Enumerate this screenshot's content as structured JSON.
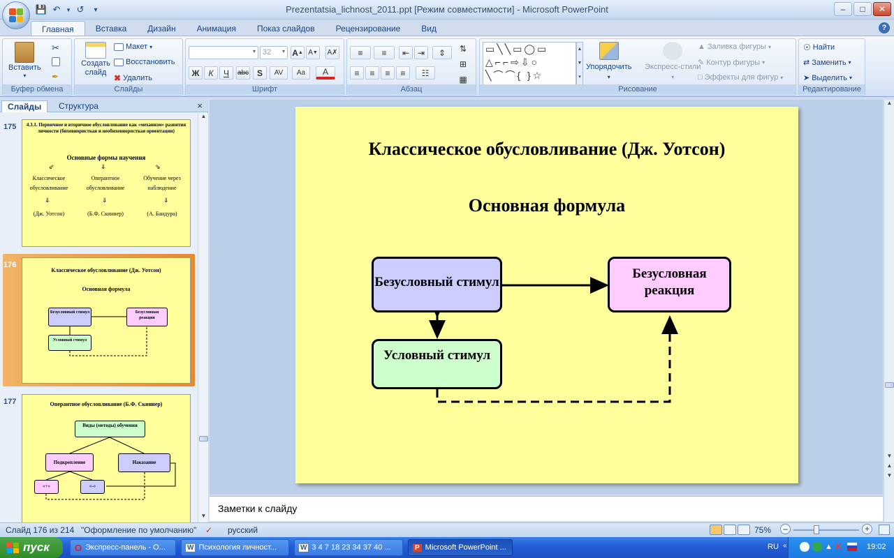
{
  "window": {
    "title": "Prezentatsia_lichnost_2011.ppt [Режим совместимости] - Microsoft PowerPoint",
    "tabs": [
      "Главная",
      "Вставка",
      "Дизайн",
      "Анимация",
      "Показ слайдов",
      "Рецензирование",
      "Вид"
    ],
    "active_tab": "Главная"
  },
  "ribbon": {
    "clipboard": {
      "label": "Буфер обмена",
      "paste": "Вставить"
    },
    "slides": {
      "label": "Слайды",
      "new_slide": "Создать слайд",
      "layout": "Макет",
      "reset": "Восстановить",
      "delete": "Удалить"
    },
    "font": {
      "label": "Шрифт",
      "font_name": "",
      "font_size": "32"
    },
    "paragraph": {
      "label": "Абзац"
    },
    "drawing": {
      "label": "Рисование",
      "arrange": "Упорядочить",
      "quick_styles": "Экспресс-стили",
      "shape_fill": "Заливка фигуры",
      "shape_outline": "Контур фигуры",
      "shape_effects": "Эффекты для фигур"
    },
    "editing": {
      "label": "Редактирование",
      "find": "Найти",
      "replace": "Заменить",
      "select": "Выделить"
    }
  },
  "panel": {
    "tabs": [
      "Слайды",
      "Структура"
    ],
    "slides": [
      {
        "number": "175",
        "title": "4.3.1. Первичное и вторичное обусловливание как «механизм» развития личности (бихевиористкая и необихевиористкая ориентации)",
        "subtitle": "Основные формы научения",
        "columns": [
          {
            "label": "Классическое обусловливание",
            "author": "(Дж. Уотсон)"
          },
          {
            "label": "Оперантное обусловливание",
            "author": "(Б.Ф. Скиннер)"
          },
          {
            "label": "Обучение через наблюдение",
            "author": "(А. Бандура)"
          }
        ]
      },
      {
        "number": "176",
        "title": "Классическое  обусловливание (Дж. Уотсон)",
        "subtitle": "Основная формула",
        "box1": "Безусловный стимул",
        "box2": "Безусловная реакция",
        "box3": "Условный стимул"
      },
      {
        "number": "177",
        "title": "Оперантное обусловливание (Б.Ф. Скиннер)",
        "top": "Виды (методы) обучения",
        "left": "Подкрепление",
        "right": "Наказание",
        "plus": "«+»",
        "minus": "«-»"
      }
    ]
  },
  "slide": {
    "title": "Классическое  обусловливание (Дж. Уотсон)",
    "subtitle": "Основная формула",
    "boxes": {
      "unconditioned_stimulus": "Безусловный стимул",
      "unconditioned_response": "Безусловная реакция",
      "conditioned_stimulus": "Условный стимул"
    },
    "colors": {
      "background": "#ffff9c",
      "stimulus": "#ccccff",
      "response": "#ffccff",
      "conditioned": "#ccffcc"
    }
  },
  "notes": {
    "placeholder": "Заметки к слайду"
  },
  "status": {
    "slide_counter": "Слайд 176 из 214",
    "theme": "\"Оформление по умолчанию\"",
    "language": "русский",
    "zoom": "75%"
  },
  "taskbar": {
    "start": "пуск",
    "buttons": [
      "Экспресс-панель - О...",
      "Психология личност...",
      "3 4 7 18 23 34 37 40 ...",
      "Microsoft PowerPoint ..."
    ],
    "lang": "RU",
    "clock": "19:02"
  }
}
